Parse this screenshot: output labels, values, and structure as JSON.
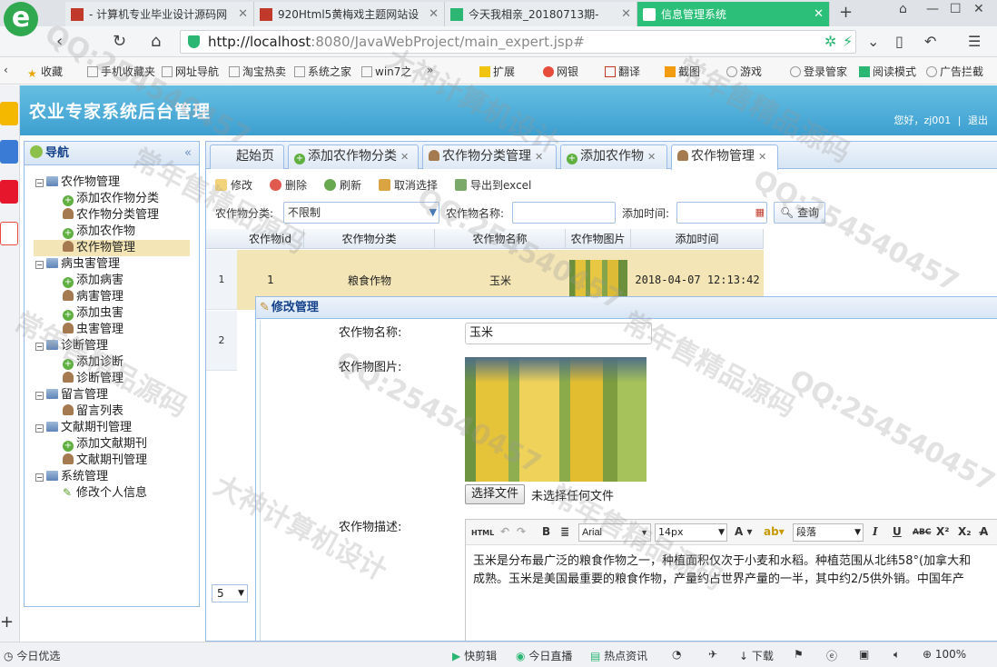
{
  "browser": {
    "tabs": [
      {
        "title": "- 计算机专业毕业设计源码网",
        "color": "#c0392b"
      },
      {
        "title": "920Html5黄梅戏主题网站设",
        "color": "#c0392b"
      },
      {
        "title": "今天我相亲_20180713期-",
        "color": "#2bb673"
      },
      {
        "title": "信息管理系统",
        "color": "#2bbf7a"
      }
    ],
    "url_host": "http://localhost",
    "url_path": ":8080/JavaWebProject/main_expert.jsp#",
    "favorites": [
      "收藏",
      "手机收藏夹",
      "网址导航",
      "淘宝热卖",
      "系统之家",
      "win7之",
      "»",
      "扩展",
      "网银",
      "翻译",
      "截图",
      "游戏",
      "登录管家",
      "阅读模式",
      "广告拦截"
    ]
  },
  "app": {
    "title": "农业专家系统后台管理",
    "greeting": "您好，zj001",
    "separator": "|",
    "logout": "退出"
  },
  "nav": {
    "title": "导航",
    "collapse": "«",
    "groups": [
      {
        "label": "农作物管理",
        "items": [
          "添加农作物分类",
          "农作物分类管理",
          "添加农作物",
          "农作物管理"
        ]
      },
      {
        "label": "病虫害管理",
        "items": [
          "添加病害",
          "病害管理",
          "添加虫害",
          "虫害管理"
        ]
      },
      {
        "label": "诊断管理",
        "items": [
          "添加诊断",
          "诊断管理"
        ]
      },
      {
        "label": "留言管理",
        "items": [
          "留言列表"
        ]
      },
      {
        "label": "文献期刊管理",
        "items": [
          "添加文献期刊",
          "文献期刊管理"
        ]
      },
      {
        "label": "系统管理",
        "items": [
          "修改个人信息"
        ]
      }
    ]
  },
  "content_tabs": [
    "起始页",
    "添加农作物分类",
    "农作物分类管理",
    "添加农作物",
    "农作物管理"
  ],
  "toolbar": {
    "edit": "修改",
    "delete": "删除",
    "refresh": "刷新",
    "unselect": "取消选择",
    "export": "导出到excel"
  },
  "filters": {
    "category_label": "农作物分类:",
    "category_value": "不限制",
    "name_label": "农作物名称:",
    "time_label": "添加时间:",
    "search": "查询"
  },
  "grid": {
    "columns": [
      "农作物id",
      "农作物分类",
      "农作物名称",
      "农作物图片",
      "添加时间"
    ],
    "rows": [
      {
        "num": "1",
        "id": "1",
        "category": "粮食作物",
        "name": "玉米",
        "time": "2018-04-07 12:13:42"
      },
      {
        "num": "2"
      }
    ],
    "page_size": "5"
  },
  "edit_panel": {
    "title": "修改管理",
    "name_label": "农作物名称:",
    "name_value": "玉米",
    "image_label": "农作物图片:",
    "choose_file": "选择文件",
    "no_file": "未选择任何文件",
    "desc_label": "农作物描述:",
    "editor": {
      "html": "HTML",
      "bold": "B",
      "font": "Arial",
      "size": "14px",
      "color": "A",
      "paragraph": "段落",
      "italic": "I",
      "underline": "U",
      "strike": "ABC",
      "sup": "X²",
      "sub": "X₂"
    },
    "description_line1": "玉米是分布最广泛的粮食作物之一，种植面积仅次于小麦和水稻。种植范围从北纬58°(加拿大和",
    "description_line2": "成熟。玉米是美国最重要的粮食作物，产量约占世界产量的一半，其中约2/5供外销。中国年产"
  },
  "statusbar": {
    "left": "今日优选",
    "items": [
      "快剪辑",
      "今日直播",
      "热点资讯",
      "下载"
    ],
    "zoom": "100%"
  },
  "watermarks": [
    "QQ:254540457",
    "常年售精品源码",
    "大神计算机设计"
  ]
}
